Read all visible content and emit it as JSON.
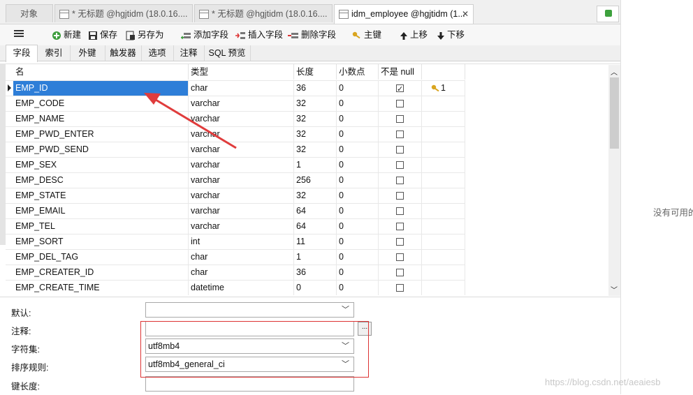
{
  "tabs": [
    {
      "label": "对象",
      "active": false,
      "icon": "none"
    },
    {
      "label": "* 无标题 @hgjtidm (18.0.16....",
      "active": false,
      "icon": "table-icon"
    },
    {
      "label": "* 无标题 @hgjtidm (18.0.16....",
      "active": false,
      "icon": "table-icon"
    },
    {
      "label": "idm_employee @hgjtidm (1...",
      "active": true,
      "icon": "table-icon"
    }
  ],
  "tab_close_glyph": "✕",
  "toolbar": {
    "new": "新建",
    "save": "保存",
    "saveas": "另存为",
    "add_field": "添加字段",
    "insert_field": "插入字段",
    "delete_field": "删除字段",
    "primary_key": "主键",
    "move_up": "上移",
    "move_down": "下移"
  },
  "subtabs": [
    "字段",
    "索引",
    "外键",
    "触发器",
    "选项",
    "注释",
    "SQL 预览"
  ],
  "columns": [
    "名",
    "类型",
    "长度",
    "小数点",
    "不是 null",
    ""
  ],
  "rows": [
    {
      "name": "EMP_ID",
      "type": "char",
      "length": "36",
      "decimals": "0",
      "not_null": true,
      "key": "1"
    },
    {
      "name": "EMP_CODE",
      "type": "varchar",
      "length": "32",
      "decimals": "0",
      "not_null": false,
      "key": ""
    },
    {
      "name": "EMP_NAME",
      "type": "varchar",
      "length": "32",
      "decimals": "0",
      "not_null": false,
      "key": ""
    },
    {
      "name": "EMP_PWD_ENTER",
      "type": "varchar",
      "length": "32",
      "decimals": "0",
      "not_null": false,
      "key": ""
    },
    {
      "name": "EMP_PWD_SEND",
      "type": "varchar",
      "length": "32",
      "decimals": "0",
      "not_null": false,
      "key": ""
    },
    {
      "name": "EMP_SEX",
      "type": "varchar",
      "length": "1",
      "decimals": "0",
      "not_null": false,
      "key": ""
    },
    {
      "name": "EMP_DESC",
      "type": "varchar",
      "length": "256",
      "decimals": "0",
      "not_null": false,
      "key": ""
    },
    {
      "name": "EMP_STATE",
      "type": "varchar",
      "length": "32",
      "decimals": "0",
      "not_null": false,
      "key": ""
    },
    {
      "name": "EMP_EMAIL",
      "type": "varchar",
      "length": "64",
      "decimals": "0",
      "not_null": false,
      "key": ""
    },
    {
      "name": "EMP_TEL",
      "type": "varchar",
      "length": "64",
      "decimals": "0",
      "not_null": false,
      "key": ""
    },
    {
      "name": "EMP_SORT",
      "type": "int",
      "length": "11",
      "decimals": "0",
      "not_null": false,
      "key": ""
    },
    {
      "name": "EMP_DEL_TAG",
      "type": "char",
      "length": "1",
      "decimals": "0",
      "not_null": false,
      "key": ""
    },
    {
      "name": "EMP_CREATER_ID",
      "type": "char",
      "length": "36",
      "decimals": "0",
      "not_null": false,
      "key": ""
    },
    {
      "name": "EMP_CREATE_TIME",
      "type": "datetime",
      "length": "0",
      "decimals": "0",
      "not_null": false,
      "key": ""
    }
  ],
  "properties": {
    "default_label": "默认:",
    "default_value": "",
    "comment_label": "注释:",
    "comment_value": "",
    "charset_label": "字符集:",
    "charset_value": "utf8mb4",
    "collation_label": "排序规则:",
    "collation_value": "utf8mb4_general_ci",
    "keylen_label": "键长度:",
    "keylen_value": "",
    "browse_button": "..."
  },
  "right_pane_text": "没有可用的",
  "watermark": "https://blog.csdn.net/aeaiesb",
  "colors": {
    "selection": "#2e7ed8",
    "annotation": "#e03c3c",
    "key_icon": "#d9a520"
  }
}
